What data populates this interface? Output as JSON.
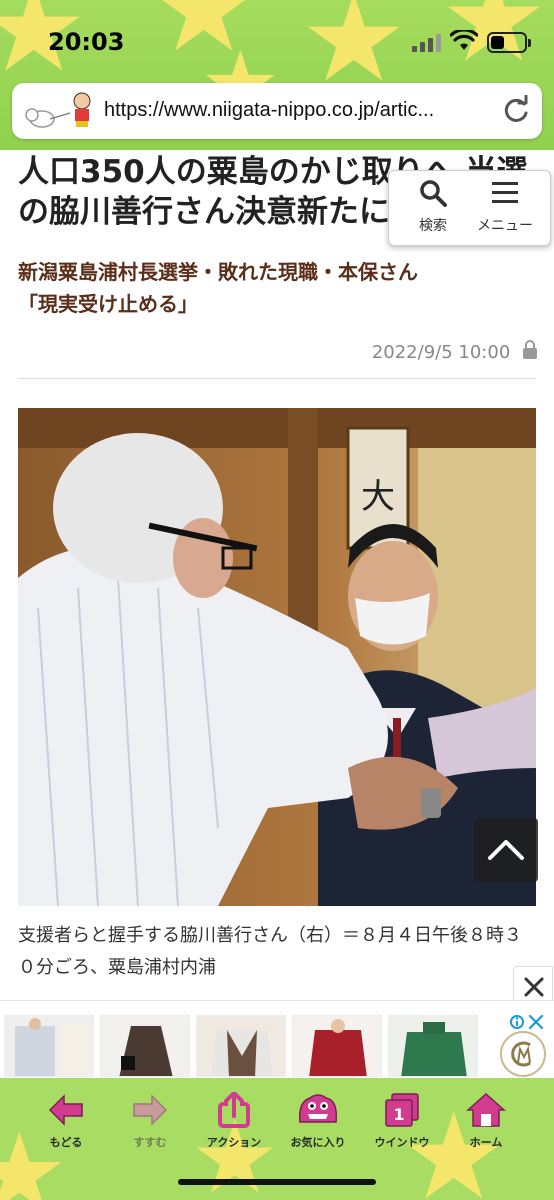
{
  "status_bar": {
    "time": "20:03",
    "battery_percent": 40
  },
  "browser": {
    "url": "https://www.niigata-nippo.co.jp/artic..."
  },
  "article": {
    "headline": "人口350人の粟島のかじ取りへ 当選の脇川善行さん決意新たに",
    "subhead_line1": "新潟粟島浦村長選挙・敗れた現職・本保さん",
    "subhead_line2": "「現実受け止める」",
    "date": "2022/9/5 10:00",
    "photo_sign_char": "大",
    "caption": "支援者らと握手する脇川善行さん（右）＝８月４日午後８時３０分ごろ、粟島浦村内浦"
  },
  "search_menu": {
    "search_label": "検索",
    "menu_label": "メニュー"
  },
  "toolbar": {
    "back": "もどる",
    "forward": "すすむ",
    "action": "アクション",
    "favorites": "お気に入り",
    "window": "ウインドウ",
    "window_count": "1",
    "home": "ホーム"
  },
  "colors": {
    "theme_green": "#8fd14f",
    "star_yellow": "#f4e66a",
    "subhead_brown": "#5b2e1a",
    "icon_pink": "#d13c8f"
  },
  "ad": {
    "choices_icon": "ad-choices-icon",
    "close_icon": "close-icon"
  }
}
